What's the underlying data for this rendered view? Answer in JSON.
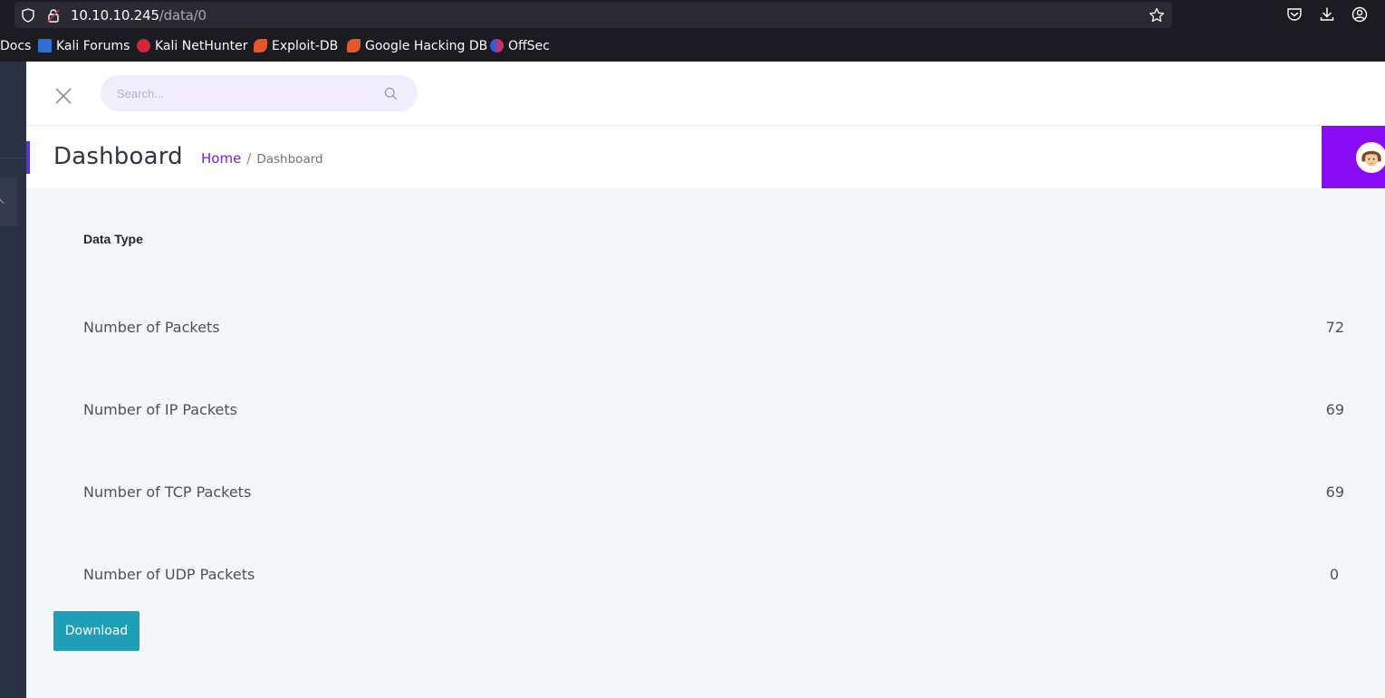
{
  "browser": {
    "url_host": "10.10.10.245",
    "url_path": "/data/0",
    "bookmarks": [
      {
        "label": "Docs",
        "icon": "none"
      },
      {
        "label": "Kali Forums",
        "icon": "kali-forums-icon"
      },
      {
        "label": "Kali NetHunter",
        "icon": "nethunter-icon"
      },
      {
        "label": "Exploit-DB",
        "icon": "exploit-db-icon"
      },
      {
        "label": "Google Hacking DB",
        "icon": "ghdb-icon"
      },
      {
        "label": "OffSec",
        "icon": "offsec-icon"
      }
    ]
  },
  "header": {
    "search_placeholder": "Search..."
  },
  "page": {
    "title": "Dashboard",
    "breadcrumb": {
      "home": "Home",
      "separator": "/",
      "current": "Dashboard"
    }
  },
  "table": {
    "header": "Data Type",
    "rows": [
      {
        "label": "Number of Packets",
        "value": "72"
      },
      {
        "label": "Number of IP Packets",
        "value": "69"
      },
      {
        "label": "Number of TCP Packets",
        "value": "69"
      },
      {
        "label": "Number of UDP Packets",
        "value": "0"
      }
    ]
  },
  "actions": {
    "download_label": "Download"
  },
  "colors": {
    "accent_purple": "#8a0cf4",
    "link_purple": "#6f21ea",
    "download_teal": "#1f9fb5",
    "sidebar_dark": "#2a3142"
  }
}
